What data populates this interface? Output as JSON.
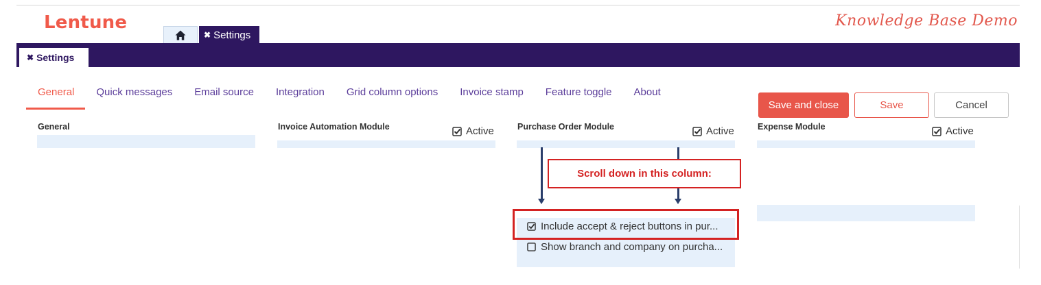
{
  "header": {
    "logo": "Lentune",
    "kb_title": "Knowledge Base Demo",
    "top_tab_label": "Settings",
    "nav_tab_label": "Settings"
  },
  "tabs": [
    {
      "label": "General",
      "active": true
    },
    {
      "label": "Quick messages",
      "active": false
    },
    {
      "label": "Email source",
      "active": false
    },
    {
      "label": "Integration",
      "active": false
    },
    {
      "label": "Grid column options",
      "active": false
    },
    {
      "label": "Invoice stamp",
      "active": false
    },
    {
      "label": "Feature toggle",
      "active": false
    },
    {
      "label": "About",
      "active": false
    }
  ],
  "buttons": {
    "save_close": "Save and close",
    "save": "Save",
    "cancel": "Cancel"
  },
  "columns": {
    "general": {
      "title": "General"
    },
    "invoice": {
      "title": "Invoice Automation Module",
      "active_label": "Active",
      "active": true
    },
    "purchase": {
      "title": "Purchase Order Module",
      "active_label": "Active",
      "active": true,
      "items": [
        {
          "label": "Include accept & reject buttons in pur...",
          "checked": true
        },
        {
          "label": "Show branch and company on purcha...",
          "checked": false
        }
      ]
    },
    "expense": {
      "title": "Expense Module",
      "active_label": "Active",
      "active": true
    }
  },
  "annotation": {
    "callout": "Scroll down in this column:",
    "color": "#d42222"
  },
  "colors": {
    "brand": "#f05a4a",
    "navbar": "#2e1760",
    "tab_text": "#5b3d9a",
    "panel": "#e6f0fb"
  }
}
